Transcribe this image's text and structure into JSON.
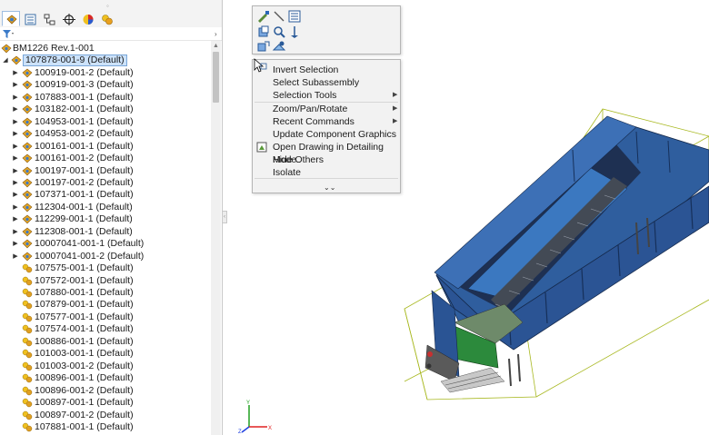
{
  "panel": {
    "tabs": [
      {
        "icon": "feature-manager-icon",
        "active": true
      },
      {
        "icon": "property-manager-icon",
        "active": false
      },
      {
        "icon": "configuration-manager-icon",
        "active": false
      },
      {
        "icon": "dimxpert-manager-icon",
        "active": false
      },
      {
        "icon": "display-manager-icon",
        "active": false
      },
      {
        "icon": "appearances-icon",
        "active": false
      }
    ],
    "filter_icon": "filter-icon",
    "tree": {
      "root": "BM1226 Rev.1-001",
      "selected": "107878-001-9 (Default)",
      "items": [
        {
          "label": "100919-001-2 (Default)",
          "expandable": true
        },
        {
          "label": "100919-001-3 (Default)",
          "expandable": true
        },
        {
          "label": "107883-001-1 (Default)",
          "expandable": true
        },
        {
          "label": "103182-001-1 (Default)",
          "expandable": true
        },
        {
          "label": "104953-001-1 (Default)",
          "expandable": true
        },
        {
          "label": "104953-001-2 (Default)",
          "expandable": true
        },
        {
          "label": "100161-001-1 (Default)",
          "expandable": true
        },
        {
          "label": "100161-001-2 (Default)",
          "expandable": true
        },
        {
          "label": "100197-001-1 (Default)",
          "expandable": true
        },
        {
          "label": "100197-001-2 (Default)",
          "expandable": true
        },
        {
          "label": "107371-001-1 (Default)",
          "expandable": true
        },
        {
          "label": "112304-001-1 (Default)",
          "expandable": true
        },
        {
          "label": "112299-001-1 (Default)",
          "expandable": true
        },
        {
          "label": "112308-001-1 (Default)",
          "expandable": true
        },
        {
          "label": "10007041-001-1 (Default)",
          "expandable": true
        },
        {
          "label": "10007041-001-2 (Default)",
          "expandable": true
        },
        {
          "label": "107575-001-1 (Default)",
          "expandable": false
        },
        {
          "label": "107572-001-1 (Default)",
          "expandable": false
        },
        {
          "label": "107880-001-1 (Default)",
          "expandable": false
        },
        {
          "label": "107879-001-1 (Default)",
          "expandable": false
        },
        {
          "label": "107577-001-1 (Default)",
          "expandable": false
        },
        {
          "label": "107574-001-1 (Default)",
          "expandable": false
        },
        {
          "label": "100886-001-1 (Default)",
          "expandable": false
        },
        {
          "label": "101003-001-1 (Default)",
          "expandable": false
        },
        {
          "label": "101003-001-2 (Default)",
          "expandable": false
        },
        {
          "label": "100896-001-1 (Default)",
          "expandable": false
        },
        {
          "label": "100896-001-2 (Default)",
          "expandable": false
        },
        {
          "label": "100897-001-1 (Default)",
          "expandable": false
        },
        {
          "label": "100897-001-2 (Default)",
          "expandable": false
        },
        {
          "label": "107881-001-1 (Default)",
          "expandable": false
        }
      ]
    }
  },
  "context_toolbar": {
    "buttons": [
      "edit-component-icon",
      "line-icon",
      "component-properties-icon",
      "open-part-icon",
      "zoom-to-selection-icon",
      "normal-to-icon",
      "hide-components-icon",
      "view-orientation-icon"
    ]
  },
  "context_menu": {
    "items": [
      {
        "label": "Invert Selection",
        "mnemonic": "I",
        "submenu": false,
        "icon": ""
      },
      {
        "label": "Select Subassembly",
        "mnemonic": "S",
        "submenu": false,
        "icon": ""
      },
      {
        "label": "Selection Tools",
        "mnemonic": "",
        "submenu": true,
        "icon": ""
      },
      {
        "label": "Zoom/Pan/Rotate",
        "mnemonic": "Z",
        "submenu": true,
        "icon": ""
      },
      {
        "label": "Recent Commands",
        "mnemonic": "R",
        "submenu": true,
        "icon": ""
      },
      {
        "label": "Update Component Graphics",
        "mnemonic": "U",
        "submenu": false,
        "icon": ""
      },
      {
        "label": "Open Drawing in Detailing Mode",
        "mnemonic": "O",
        "submenu": false,
        "icon": "drawing-icon"
      },
      {
        "label": "Hide Others",
        "mnemonic": "d",
        "submenu": false,
        "icon": ""
      },
      {
        "label": "Isolate",
        "mnemonic": "l",
        "submenu": false,
        "icon": ""
      }
    ],
    "expand_icon": "double-chevron-down-icon"
  },
  "triad": {
    "y": "Y",
    "x": "X",
    "z": "Z"
  },
  "colors": {
    "selection_bg": "#cce2fa",
    "selection_border": "#7aa7d8",
    "model_blue": "#2c5aa0",
    "model_dark": "#1f3a66",
    "bounding_box": "#a8b820",
    "triad_x": "#e02020",
    "triad_y": "#20a020",
    "triad_z": "#2040e0"
  }
}
